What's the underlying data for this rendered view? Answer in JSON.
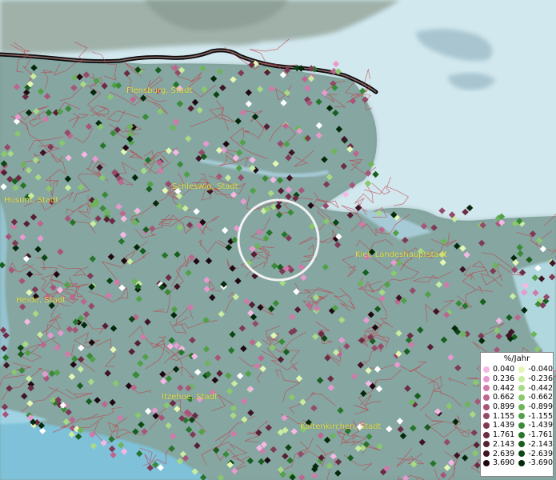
{
  "map": {
    "cities": [
      {
        "id": "flensburg",
        "label": "Flensburg, Stadt"
      },
      {
        "id": "husum",
        "label": "Husum, Stadt"
      },
      {
        "id": "schleswig",
        "label": "Schleswig, Stadt"
      },
      {
        "id": "kiel",
        "label": "Kiel, Landeshauptstadt"
      },
      {
        "id": "heide",
        "label": "Heide, Stadt"
      },
      {
        "id": "itzehoe",
        "label": "Itzehoe, Stadt"
      },
      {
        "id": "kaltenkirchen",
        "label": "Kaltenkirchen, Stadt"
      }
    ]
  },
  "legend": {
    "title": "%/Jahr",
    "positive": [
      {
        "label": "0.040",
        "color": "#f5b8e4"
      },
      {
        "label": "0.236",
        "color": "#e79ad0"
      },
      {
        "label": "0.442",
        "color": "#d07aaa"
      },
      {
        "label": "0.662",
        "color": "#bd668f"
      },
      {
        "label": "0.899",
        "color": "#a8557a"
      },
      {
        "label": "1.155",
        "color": "#944a68"
      },
      {
        "label": "1.439",
        "color": "#7f3a56"
      },
      {
        "label": "1.761",
        "color": "#6b2c44"
      },
      {
        "label": "2.143",
        "color": "#561f33"
      },
      {
        "label": "2.639",
        "color": "#3f1424"
      },
      {
        "label": "3.690",
        "color": "#200810"
      }
    ],
    "negative": [
      {
        "label": "-0.040",
        "color": "#e4f7b4"
      },
      {
        "label": "-0.236",
        "color": "#c8eca0"
      },
      {
        "label": "-0.442",
        "color": "#a8da86"
      },
      {
        "label": "-0.662",
        "color": "#8ac86e"
      },
      {
        "label": "-0.899",
        "color": "#6db45a"
      },
      {
        "label": "-1.155",
        "color": "#52a048"
      },
      {
        "label": "-1.439",
        "color": "#3a8a38"
      },
      {
        "label": "-1.761",
        "color": "#27752a"
      },
      {
        "label": "-2.143",
        "color": "#185e1e"
      },
      {
        "label": "-2.639",
        "color": "#0c4613"
      },
      {
        "label": "-3.690",
        "color": "#03280a"
      }
    ]
  }
}
